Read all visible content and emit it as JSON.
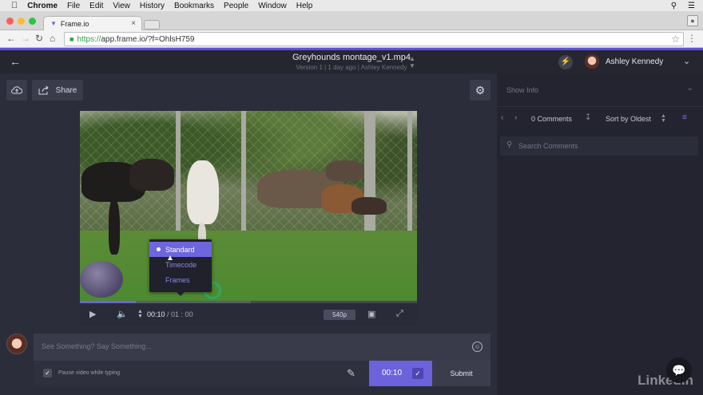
{
  "menubar": {
    "app": "Chrome",
    "items": [
      "File",
      "Edit",
      "View",
      "History",
      "Bookmarks",
      "People",
      "Window",
      "Help"
    ]
  },
  "browser": {
    "tab_title": "Frame.io",
    "url_secure": "https://",
    "url_rest": "app.frame.io/?f=OhlsH759"
  },
  "header": {
    "file_title": "Greyhounds montage_v1.mp4",
    "file_meta": "Version 1  |  1 day ago  |  Ashley Kennedy",
    "user_name": "Ashley Kennedy"
  },
  "toolbar": {
    "share_label": "Share"
  },
  "player": {
    "progress": 0.165,
    "buffered": 0.507,
    "current_time": "00:10",
    "duration": "/ 01 : 00",
    "resolution": "540p",
    "time_format_options": [
      "Standard",
      "Timecode",
      "Frames"
    ],
    "selected_format": "Standard"
  },
  "composer": {
    "placeholder": "See Something? Say Something...",
    "pause_label": "Pause video while typing",
    "time_value": "00:10",
    "submit_label": "Submit"
  },
  "sidebar": {
    "show_info": "Show Info",
    "comment_count": "0 Comments",
    "sort_label": "Sort by Oldest",
    "search_placeholder": "Search Comments"
  },
  "watermark": "LinkedIn",
  "colors": {
    "accent": "#6b62dc",
    "header_stripe": "#5b55d6",
    "panel": "#2c2d3a",
    "sidebar": "#23242f"
  }
}
